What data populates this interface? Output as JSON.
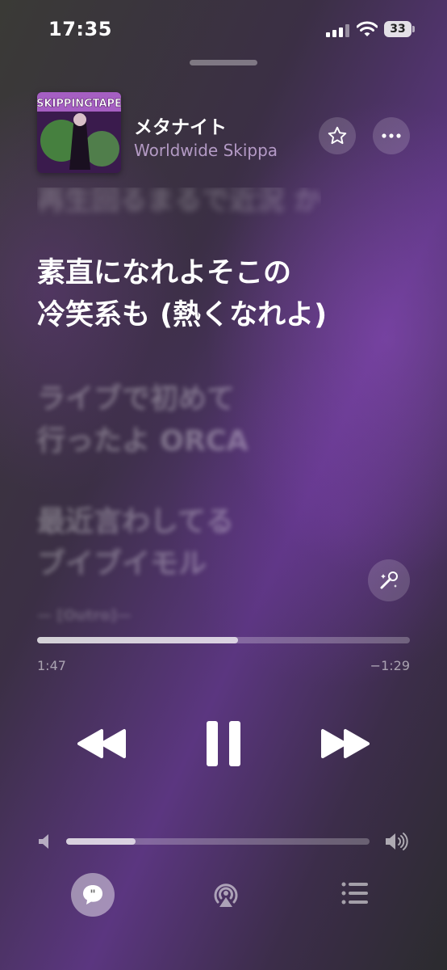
{
  "status_bar": {
    "time": "17:35",
    "battery": "33"
  },
  "now_playing": {
    "title": "メタナイト",
    "artist": "Worldwide Skippa",
    "artwork_text": "SKIPPINGTAPE"
  },
  "lyrics": {
    "previous": "再生回るまるで近況 か",
    "current": [
      "素直になれよそこの",
      "冷笑系も (熱くなれよ)"
    ],
    "next": [
      [
        "ライブで初めて",
        "行ったよ ORCA"
      ],
      [
        "最近言わしてる",
        "ブイブイモル"
      ]
    ],
    "next_partial": "— [Outro]—"
  },
  "playback": {
    "elapsed": "1:47",
    "remaining": "−1:29",
    "progress": 0.54,
    "volume": 0.23
  },
  "icons": {
    "star": "star-icon",
    "more": "ellipsis-icon",
    "sing": "microphone-sparkle-icon",
    "rewind": "backward-icon",
    "pause": "pause-icon",
    "forward": "forward-icon",
    "lyrics": "quote-bubble-icon",
    "airplay": "airplay-icon",
    "queue": "list-icon"
  },
  "colors": {
    "accent_bg": "#5b3680",
    "artist_text": "#dcbef0"
  }
}
